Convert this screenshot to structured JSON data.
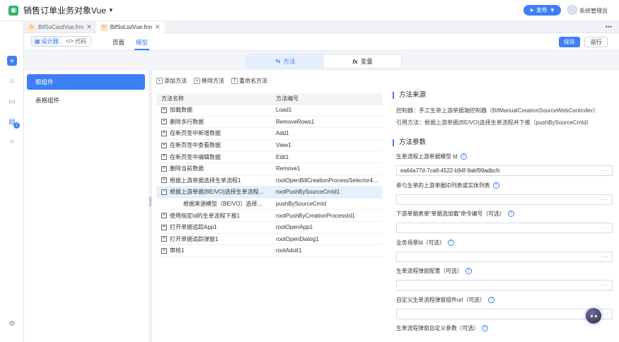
{
  "app": {
    "title": "销售订单业务对象Vue",
    "publish_label": "发布",
    "username": "系统管理员"
  },
  "file_tabs": [
    {
      "label": "BifSoCardVue.frm"
    },
    {
      "label": "BifSoListVue.frm"
    }
  ],
  "toolbar": {
    "designer": "设计器",
    "code": "代码",
    "tab_page": "页面",
    "tab_model": "模型",
    "save": "保存",
    "run": "运行"
  },
  "segment": {
    "methods": "方法",
    "variables": "变量"
  },
  "components": [
    {
      "label": "根组件"
    },
    {
      "label": "表格组件"
    }
  ],
  "actions": {
    "add": "添加方法",
    "remove": "移除方法",
    "rename": "重命名方法"
  },
  "grid": {
    "col_name": "方法名称",
    "col_code": "方法编号",
    "rows": [
      {
        "name": "加载数据",
        "code": "Load1"
      },
      {
        "name": "删除多行数据",
        "code": "RemoveRows1"
      },
      {
        "name": "在新页签中新增数据",
        "code": "Add1"
      },
      {
        "name": "在新页签中查看数据",
        "code": "View1"
      },
      {
        "name": "在新页签中编辑数据",
        "code": "Edit1"
      },
      {
        "name": "删除当前数据",
        "code": "Remove1"
      },
      {
        "name": "根据上游单据选择生单流程1",
        "code": "rootOpenBillCreationProcessSelector4Pus..."
      },
      {
        "name": "根据上游单据(BE/VO)选择生单流程...",
        "code": "rootPushBySourceCmId1"
      },
      {
        "name": "根据来源模型（BE/VO）选择...",
        "code": "pushBySourceCmId"
      },
      {
        "name": "使用指定Id的生单流程下推1",
        "code": "rootPushByCreationProcessId1"
      },
      {
        "name": "打开单据追踪App1",
        "code": "rootOpenApp1"
      },
      {
        "name": "打开单据追踪弹窗1",
        "code": "rootOpenDialog1"
      },
      {
        "name": "审核1",
        "code": "rootAduit1"
      }
    ]
  },
  "source": {
    "title": "方法来源",
    "controller": "控制器：手工生单上游单据端控制器（BifManualCreationSourceWebController）",
    "reference": "引用方法：根据上游单据(BE/VO)选择生单流程并下推（pushBySourceCmId）"
  },
  "params": {
    "title": "方法参数",
    "items": [
      {
        "label": "生单流程上游单据模型 Id",
        "value": "ea64a77d-7ca8-4522-b94f-9abf99adbcfc"
      },
      {
        "label": "参与生单的上游单据ID列表或实体列表",
        "value": ""
      },
      {
        "label": "下游单据表单\"单据流加载\"命令编号（可选）",
        "value": ""
      },
      {
        "label": "业务场景Id（可选）",
        "value": ""
      },
      {
        "label": "生单流程弹窗配置（可选）",
        "value": ""
      },
      {
        "label": "自定义生单流程弹窗组件url（可选）",
        "value": ""
      },
      {
        "label": "生单流程弹窗自定义参数（可选）",
        "value": ""
      }
    ],
    "dots": "···"
  },
  "colors": {
    "accent": "#3d7ff6",
    "selected_row": "#e6efff"
  }
}
